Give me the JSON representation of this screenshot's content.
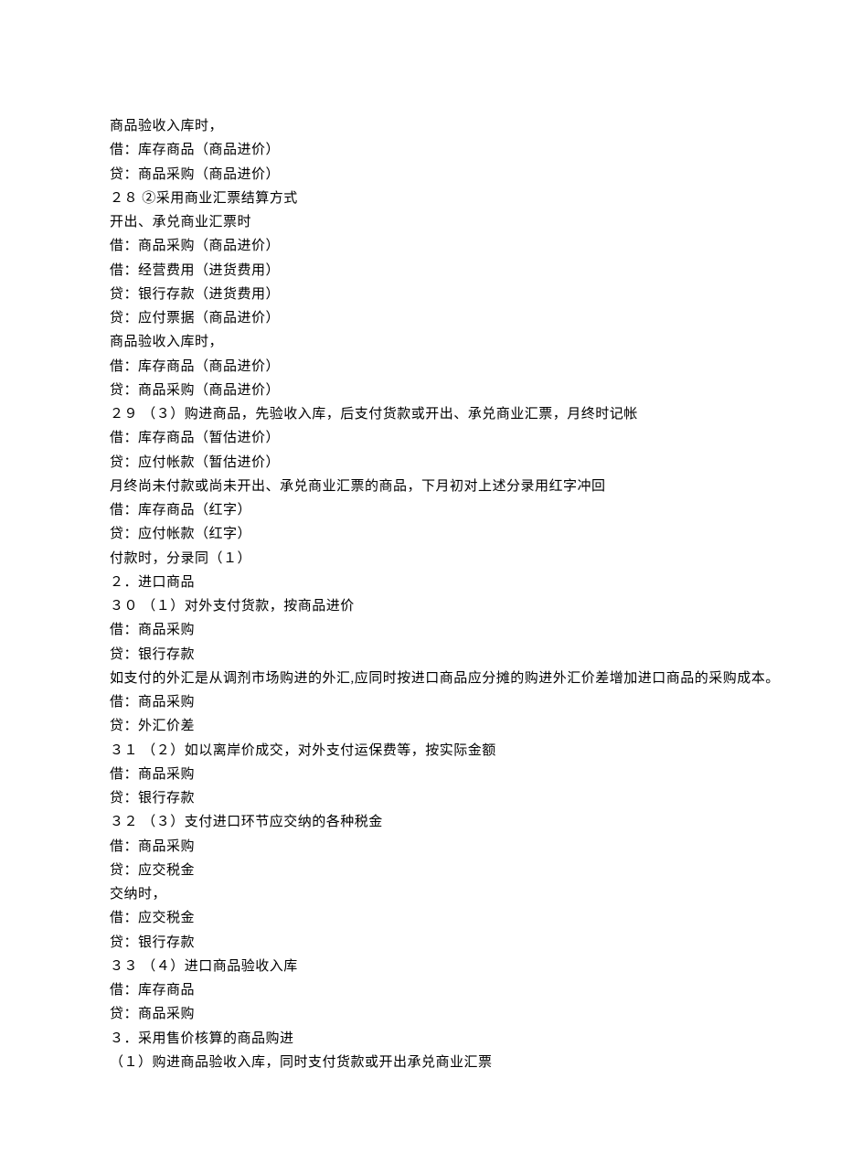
{
  "lines": [
    "商品验收入库时，",
    "借：库存商品（商品进价）",
    "贷：商品采购（商品进价）",
    "２８  ②采用商业汇票结算方式",
    "开出、承兑商业汇票时",
    "借：商品采购（商品进价）",
    "借：经营费用（进货费用）",
    "贷：银行存款（进货费用）",
    "贷：应付票据（商品进价）",
    "商品验收入库时，",
    "借：库存商品（商品进价）",
    "贷：商品采购（商品进价）",
    "２９  （３）购进商品，先验收入库，后支付货款或开出、承兑商业汇票，月终时记帐",
    "借：库存商品（暂估进价）",
    "贷：应付帐款（暂估进价）",
    "月终尚未付款或尚未开出、承兑商业汇票的商品，下月初对上述分录用红字冲回",
    "借：库存商品（红字）",
    "贷：应付帐款（红字）",
    "付款时，分录同（１）",
    "２．进口商品",
    "３０  （１）对外支付货款，按商品进价",
    "借：商品采购",
    "贷：银行存款",
    "如支付的外汇是从调剂市场购进的外汇,应同时按进口商品应分摊的购进外汇价差增加进口商品的采购成本。",
    "借：商品采购",
    "贷：外汇价差",
    "３１  （２）如以离岸价成交，对外支付运保费等，按实际金额",
    "借：商品采购",
    "贷：银行存款",
    "３２  （３）支付进口环节应交纳的各种税金",
    "借：商品采购",
    "贷：应交税金",
    "交纳时，",
    "借：应交税金",
    "贷：银行存款",
    "３３  （４）进口商品验收入库",
    "借：库存商品",
    "贷：商品采购",
    "３．采用售价核算的商品购进",
    "（１）购进商品验收入库，同时支付货款或开出承兑商业汇票"
  ]
}
